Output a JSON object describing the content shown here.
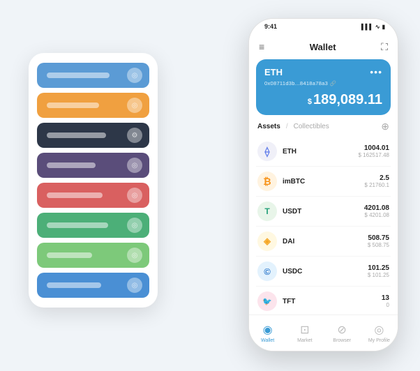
{
  "scene": {
    "cards": [
      {
        "color": "card-blue-light",
        "dotChar": "◎"
      },
      {
        "color": "card-orange",
        "dotChar": "◎"
      },
      {
        "color": "card-dark",
        "dotChar": "⚙"
      },
      {
        "color": "card-purple",
        "dotChar": "◎"
      },
      {
        "color": "card-red",
        "dotChar": "◎"
      },
      {
        "color": "card-green",
        "dotChar": "◎"
      },
      {
        "color": "card-green-light",
        "dotChar": "◎"
      },
      {
        "color": "card-blue",
        "dotChar": "◎"
      }
    ]
  },
  "statusBar": {
    "time": "9:41",
    "signal": "▌▌▌",
    "wifi": "WiFi",
    "battery": "🔋"
  },
  "header": {
    "menuIcon": "≡",
    "title": "Wallet",
    "expandIcon": "⛶"
  },
  "ethCard": {
    "title": "ETH",
    "dotsIcon": "•••",
    "address": "0x08711d3b...8418a78a3  🔗",
    "balanceSymbol": "$",
    "balance": "189,089.11"
  },
  "assetsSection": {
    "tabActive": "Assets",
    "tabSeparator": "/",
    "tabInactive": "Collectibles",
    "addIcon": "⊕"
  },
  "tokens": [
    {
      "icon": "⟠",
      "iconBg": "eth-icon-bg",
      "name": "ETH",
      "amount": "1004.01",
      "usd": "$ 162517.48"
    },
    {
      "icon": "₿",
      "iconBg": "imbtc-icon-bg",
      "name": "imBTC",
      "amount": "2.5",
      "usd": "$ 21760.1"
    },
    {
      "icon": "T",
      "iconBg": "usdt-icon-bg",
      "name": "USDT",
      "amount": "4201.08",
      "usd": "$ 4201.08"
    },
    {
      "icon": "◈",
      "iconBg": "dai-icon-bg",
      "name": "DAI",
      "amount": "508.75",
      "usd": "$ 508.75"
    },
    {
      "icon": "©",
      "iconBg": "usdc-icon-bg",
      "name": "USDC",
      "amount": "101.25",
      "usd": "$ 101.25"
    },
    {
      "icon": "🐦",
      "iconBg": "tft-icon-bg",
      "name": "TFT",
      "amount": "13",
      "usd": "0"
    }
  ],
  "bottomNav": [
    {
      "icon": "◉",
      "label": "Wallet",
      "active": true
    },
    {
      "icon": "◫",
      "label": "Market",
      "active": false
    },
    {
      "icon": "◳",
      "label": "Browser",
      "active": false
    },
    {
      "icon": "◎",
      "label": "My Profile",
      "active": false
    }
  ]
}
